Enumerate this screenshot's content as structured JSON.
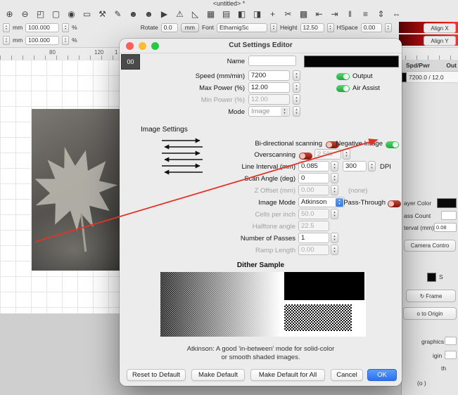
{
  "window": {
    "title": "<untitled> *"
  },
  "colors": {
    "accent_blue": "#2f7cf8",
    "toggle_on_green": "#28c840",
    "toggle_off_red": "#8e1a0d",
    "annotation_arrow_red": "#e03427",
    "layer_strip_red_dark": "#550404",
    "layer_strip_red_bright": "#ff2d2d",
    "layer_swatch_black": "#000000"
  },
  "toolbar": {
    "icons": [
      {
        "name": "zoom-in-icon",
        "glyph": "⊕"
      },
      {
        "name": "zoom-out-icon",
        "glyph": "⊖"
      },
      {
        "name": "zoom-frame-icon",
        "glyph": "◰"
      },
      {
        "name": "selection-frame-icon",
        "glyph": "▢"
      },
      {
        "name": "camera-icon",
        "glyph": "◉"
      },
      {
        "name": "monitor-icon",
        "glyph": "▭"
      },
      {
        "name": "tools-icon",
        "glyph": "⚒"
      },
      {
        "name": "pen-icon",
        "glyph": "✎"
      },
      {
        "name": "user-icon",
        "glyph": "☻"
      },
      {
        "name": "user-alt-icon",
        "glyph": "☻"
      },
      {
        "name": "start-icon",
        "glyph": "▶"
      },
      {
        "name": "warning-icon",
        "glyph": "⚠"
      },
      {
        "name": "angle-measure-icon",
        "glyph": "◺"
      },
      {
        "name": "grid-array-icon",
        "glyph": "▦"
      },
      {
        "name": "copy-array-icon",
        "glyph": "▤"
      },
      {
        "name": "mirror-horizontal-icon",
        "glyph": "◧"
      },
      {
        "name": "mirror-vertical-icon",
        "glyph": "◨"
      },
      {
        "name": "node-edit-icon",
        "glyph": "+"
      },
      {
        "name": "cut-shapes-icon",
        "glyph": "✂"
      },
      {
        "name": "weld-icon",
        "glyph": "▩"
      },
      {
        "name": "align-left-icon",
        "glyph": "⇤"
      },
      {
        "name": "align-right-icon",
        "glyph": "⇥"
      },
      {
        "name": "distribute-horizontal-icon",
        "glyph": "‖"
      },
      {
        "name": "distribute-vertical-icon",
        "glyph": "≡"
      },
      {
        "name": "space-vertical-icon",
        "glyph": "⇕"
      },
      {
        "name": "space-horizontal-icon",
        "glyph": "⇔"
      }
    ]
  },
  "transform_bar": {
    "row1": {
      "unit": "mm",
      "value": "100.000",
      "pct": "%"
    },
    "row2": {
      "unit": "mm",
      "value": "100.000",
      "pct": "%"
    },
    "rotate_label": "Rotate",
    "rotate_value": "0.0",
    "unit_button": "mm",
    "font_label": "Font",
    "font_value": "EtharnigSc",
    "height_label": "Height",
    "height_value": "12.50",
    "hspace_label": "HSpace",
    "hspace_value": "0.00",
    "align_x_label": "Align X",
    "align_y_label": "Align Y"
  },
  "ruler": {
    "ticks": [
      "80",
      "120",
      "1"
    ]
  },
  "right_panel": {
    "header_spd": "Spd/Pwr",
    "header_out": "Out",
    "row_value": "7200.0 / 12.0",
    "layer_color_label": "ayer Color",
    "pass_count_label": "ass Count",
    "interval_label": "terval (mm)",
    "interval_value": "0.08",
    "camera_button": "Camera Contro",
    "show_label": "S",
    "frame_icon": "↻",
    "frame_button": "Frame",
    "origin_button": "o to Origin",
    "frag_graphics": "graphics",
    "frag_igin": "igin",
    "frag_th": "th",
    "frag_o": "(o )"
  },
  "dialog": {
    "title": "Cut Settings Editor",
    "tab_label": "00",
    "name_label": "Name",
    "name_value": "",
    "speed_label": "Speed (mm/min)",
    "speed_value": "7200",
    "output_label": "Output",
    "max_power_label": "Max Power (%)",
    "max_power_value": "12.00",
    "air_assist_label": "Air Assist",
    "min_power_label": "Min Power (%)",
    "min_power_value": "12.00",
    "mode_label": "Mode",
    "mode_value": "Image",
    "image_settings_label": "Image Settings",
    "bidir_label": "Bi-directional scanning",
    "negative_label": "Negative Image",
    "overscan_label": "Overscanning",
    "overscan_value": "2.5%",
    "line_interval_label": "Line Interval (mm)",
    "line_interval_value": "0.085",
    "dpi_value": "300",
    "dpi_label": "DPI",
    "scan_angle_label": "Scan Angle (deg)",
    "scan_angle_value": "0",
    "z_offset_label": "Z Offset (mm)",
    "z_offset_value": "0.00",
    "none_label": "(none)",
    "image_mode_label": "Image Mode",
    "image_mode_value": "Atkinson",
    "pass_through_label": "Pass-Through",
    "cells_label": "Cells per inch",
    "cells_value": "50.0",
    "halftone_label": "Halftone angle",
    "halftone_value": "22.5",
    "passes_label": "Number of Passes",
    "passes_value": "1",
    "ramp_label": "Ramp Length",
    "ramp_value": "0.00",
    "dither_label": "Dither Sample",
    "dither_caption_1": "Atkinson: A good 'in-between' mode for solid-color",
    "dither_caption_2": "or smooth shaded images.",
    "buttons": {
      "reset": "Reset to Default",
      "make_default": "Make Default",
      "make_default_all": "Make Default for All",
      "cancel": "Cancel",
      "ok": "OK"
    }
  }
}
